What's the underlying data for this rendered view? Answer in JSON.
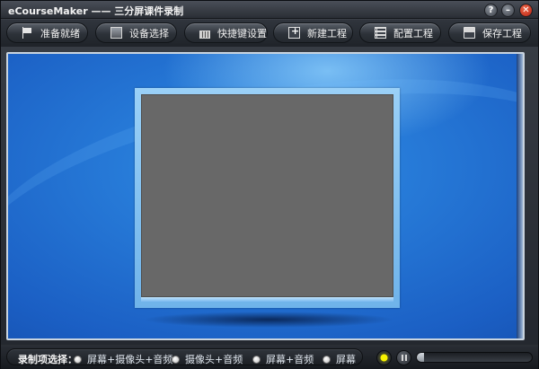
{
  "window": {
    "title": "eCourseMaker —— 三分屏课件录制",
    "controls": {
      "help": "?",
      "minimize": "–",
      "close": "✕"
    }
  },
  "toolbar": {
    "buttons": [
      {
        "label": "准备就绪",
        "icon": "flag-icon"
      },
      {
        "label": "设备选择",
        "icon": "device-icon"
      },
      {
        "label": "快捷键设置",
        "icon": "keyboard-icon"
      },
      {
        "label": "新建工程",
        "icon": "new-project-icon"
      },
      {
        "label": "配置工程",
        "icon": "config-icon"
      },
      {
        "label": "保存工程",
        "icon": "save-icon"
      }
    ]
  },
  "preview": {
    "background": "#1b5fc4",
    "screen_color": "#686868"
  },
  "bottom": {
    "record_label": "录制项选择：",
    "options": [
      {
        "label": "屏幕+摄像头+音频"
      },
      {
        "label": "摄像头+音频"
      },
      {
        "label": "屏幕+音频"
      },
      {
        "label": "屏幕"
      }
    ],
    "record_indicator_color": "#f7f200",
    "level_fraction": 0.06
  }
}
